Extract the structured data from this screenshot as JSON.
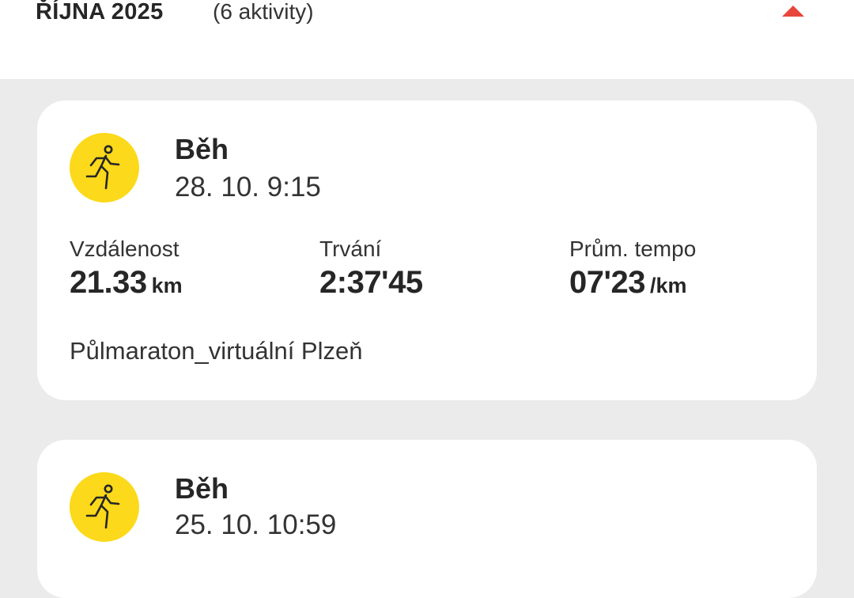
{
  "month_header": {
    "title": "ŘÍJNA 2025",
    "count": "(6 aktivity)",
    "toggle_icon": "chevron-up-icon"
  },
  "colors": {
    "accent_red": "#e8463c",
    "sport_icon_yellow": "#fcd91a",
    "background": "#ebebeb",
    "card": "#ffffff"
  },
  "activities": [
    {
      "type": "Běh",
      "icon": "running-icon",
      "date": "28. 10. 9:15",
      "stats": [
        {
          "label": "Vzdálenost",
          "value": "21.33",
          "unit": "km"
        },
        {
          "label": "Trvání",
          "value": "2:37'45",
          "unit": ""
        },
        {
          "label": "Prům. tempo",
          "value": "07'23",
          "unit": "/km"
        }
      ],
      "name": "Půlmaraton_virtuální Plzeň"
    },
    {
      "type": "Běh",
      "icon": "running-icon",
      "date": "25. 10. 10:59"
    }
  ]
}
